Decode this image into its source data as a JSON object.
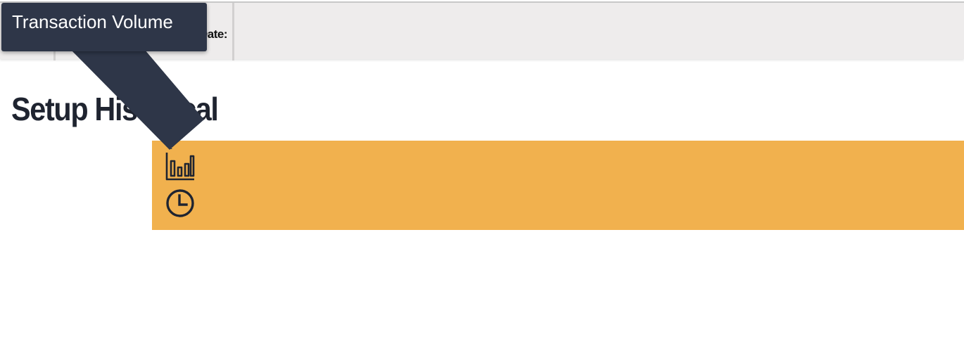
{
  "header": {
    "date_label": "Date:"
  },
  "page": {
    "title": "Setup Historical"
  },
  "toolbar": {
    "buttons": [
      {
        "icon": "bar-chart-icon",
        "tooltip": "Transaction Volume"
      },
      {
        "icon": "clock-icon"
      }
    ]
  },
  "tooltip": {
    "text": "Transaction Volume"
  },
  "colors": {
    "panel": "#f1b14e",
    "tooltip_bg": "#2e3648",
    "title": "#1f2430",
    "topbar_bg": "#eeecec"
  }
}
